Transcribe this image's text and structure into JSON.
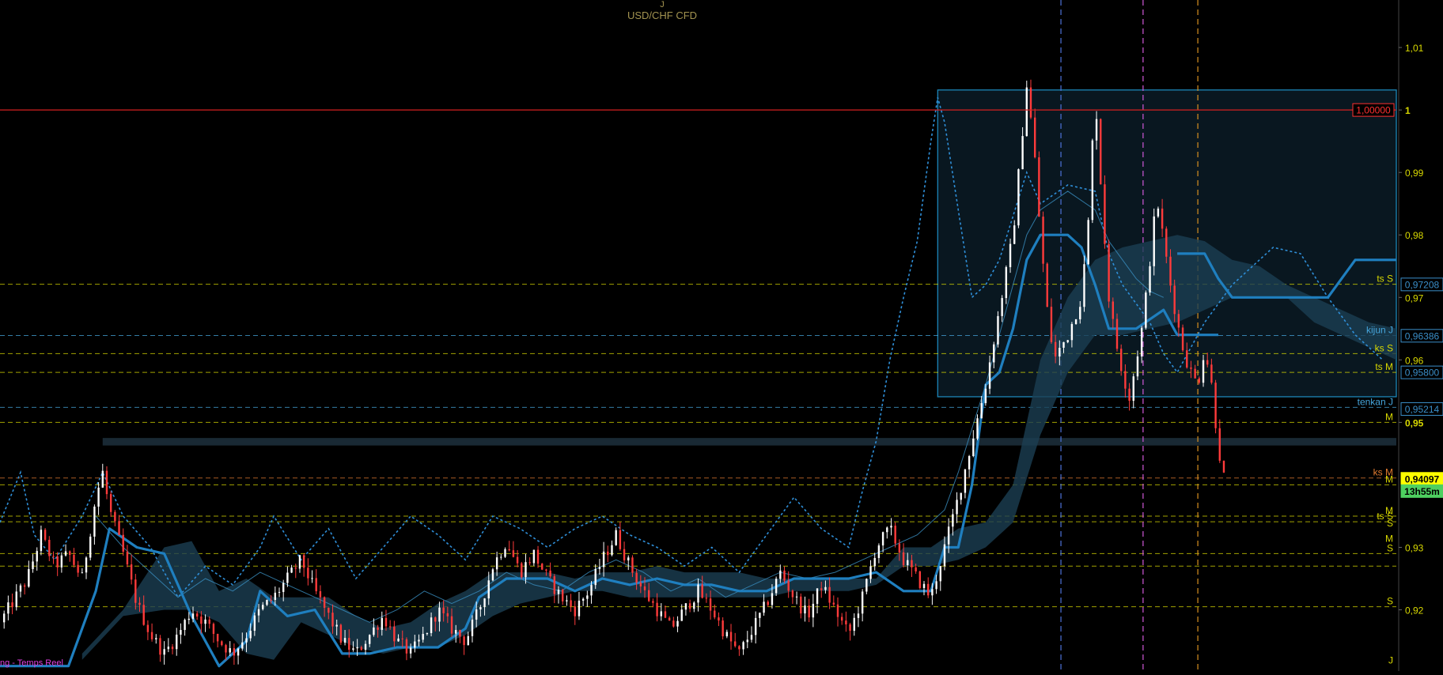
{
  "colors": {
    "background": "#000000",
    "bull_candle": "#ffffff",
    "bear_candle": "#ff3b3b",
    "kijun": "#1f7fbf",
    "tenkan_dotted": "#2f8fd8",
    "chikou_thin": "#3a8fc0",
    "cloud": "#1b3f52",
    "box_border": "#1c86b8",
    "box_fill": "#0b1b26",
    "red_line": "#d42020",
    "yellow": "#d8d800",
    "blue_label": "#46a6dc",
    "axis_text": "#d8d800",
    "title": "#a29350",
    "status": "#e040e0",
    "vline_blue": "#4c72d8",
    "vline_magenta": "#d058d8",
    "vline_orange": "#d89020"
  },
  "header": {
    "timeframe": "J",
    "instrument": "USD/CHF CFD"
  },
  "status_bar": {
    "text": "ng - Temps Reel"
  },
  "right_labels": [
    {
      "text": "ts S",
      "price": 0.9721,
      "color": "#d8d800"
    },
    {
      "text": "kijun J",
      "price": 0.9639,
      "color": "#46a6dc"
    },
    {
      "text": "ks S",
      "price": 0.961,
      "color": "#d8d800"
    },
    {
      "text": "ts M",
      "price": 0.958,
      "color": "#d8d800"
    },
    {
      "text": "tenkan J",
      "price": 0.9524,
      "color": "#46a6dc"
    },
    {
      "text": "M",
      "price": 0.95,
      "color": "#d8d800"
    },
    {
      "text": "ks M",
      "price": 0.9411,
      "color": "#e07a30"
    },
    {
      "text": "M",
      "price": 0.94,
      "color": "#d8d800"
    },
    {
      "text": "M",
      "price": 0.935,
      "color": "#d8d800"
    },
    {
      "text": "ts S",
      "price": 0.9341,
      "color": "#d8d800"
    },
    {
      "text": "S",
      "price": 0.933,
      "color": "#d8d800"
    },
    {
      "text": "M",
      "price": 0.9305,
      "color": "#d8d800"
    },
    {
      "text": "S",
      "price": 0.929,
      "color": "#d8d800"
    },
    {
      "text": "S",
      "price": 0.9205,
      "color": "#d8d800"
    },
    {
      "text": "J",
      "price": 0.911,
      "color": "#d8d800"
    }
  ],
  "price_boxes": [
    {
      "text": "1,00000",
      "price": 1.0,
      "fg": "#ff3030",
      "bg": "#000000",
      "border": "#ff3030"
    },
    {
      "text": "0,97208",
      "price": 0.97208,
      "fg": "#3a8ec8",
      "bg": "#000000",
      "border": "#3a8ec8"
    },
    {
      "text": "0,96386",
      "price": 0.96386,
      "fg": "#3a8ec8",
      "bg": "#000000",
      "border": "#3a8ec8"
    },
    {
      "text": "0,95800",
      "price": 0.958,
      "fg": "#3a8ec8",
      "bg": "#000000",
      "border": "#3a8ec8"
    },
    {
      "text": "0,95214",
      "price": 0.95214,
      "fg": "#3a8ec8",
      "bg": "#000000",
      "border": "#3a8ec8"
    },
    {
      "text": "0,94097",
      "price": 0.94097,
      "fg": "#000000",
      "bg": "#ffff00",
      "border": "#ffff00"
    },
    {
      "text": "13h55m",
      "price": 0.939,
      "fg": "#000000",
      "bg": "#4ed060",
      "border": "#4ed060"
    }
  ],
  "chart_data": {
    "type": "candlestick",
    "instrument": "USD/CHF CFD",
    "timeframe": "J",
    "y_axis": {
      "ticks": [
        "1,01",
        "1",
        "0,99",
        "0,98",
        "0,97",
        "0,96",
        "0,95",
        "0,93",
        "0,92"
      ],
      "tick_values": [
        1.01,
        1.0,
        0.99,
        0.98,
        0.97,
        0.96,
        0.95,
        0.93,
        0.92
      ],
      "bold_ticks": [
        "1",
        "0,95"
      ],
      "range": [
        0.9102,
        1.0176
      ]
    },
    "x_range": [
      0,
      204
    ],
    "last_price": 0.94097,
    "time_to_close": "13h55m",
    "resistance_line": 1.0,
    "rectangle": {
      "x0": 137,
      "x1": 204,
      "y_top": 1.0032,
      "y_bottom": 0.9541
    },
    "horizontal_zone": {
      "x0": 15,
      "x1": 204,
      "price_top": 0.9475,
      "price_bottom": 0.9463
    },
    "vertical_lines": [
      {
        "x": 155,
        "color": "#4c72d8"
      },
      {
        "x": 167,
        "color": "#d058d8"
      },
      {
        "x": 175,
        "color": "#d89020"
      }
    ],
    "level_lines": [
      {
        "price": 0.9721,
        "color": "#d8d800"
      },
      {
        "price": 0.9639,
        "color": "#46a6dc"
      },
      {
        "price": 0.961,
        "color": "#d8d800"
      },
      {
        "price": 0.958,
        "color": "#d8d800"
      },
      {
        "price": 0.9524,
        "color": "#46a6dc"
      },
      {
        "price": 0.95,
        "color": "#d8d800"
      },
      {
        "price": 0.9411,
        "color": "#e07a30"
      },
      {
        "price": 0.94,
        "color": "#d8d800"
      },
      {
        "price": 0.935,
        "color": "#d8d800"
      },
      {
        "price": 0.9341,
        "color": "#d8d800"
      },
      {
        "price": 0.929,
        "color": "#d8d800"
      },
      {
        "price": 0.927,
        "color": "#d8d800"
      },
      {
        "price": 0.9205,
        "color": "#d8d800"
      }
    ],
    "price_path": [
      [
        0,
        0.918
      ],
      [
        4,
        0.925
      ],
      [
        6,
        0.932
      ],
      [
        8,
        0.927
      ],
      [
        10,
        0.929
      ],
      [
        12,
        0.925
      ],
      [
        14,
        0.938
      ],
      [
        15,
        0.942
      ],
      [
        16,
        0.936
      ],
      [
        18,
        0.929
      ],
      [
        20,
        0.921
      ],
      [
        22,
        0.916
      ],
      [
        24,
        0.913
      ],
      [
        26,
        0.916
      ],
      [
        28,
        0.92
      ],
      [
        30,
        0.918
      ],
      [
        32,
        0.915
      ],
      [
        34,
        0.913
      ],
      [
        36,
        0.916
      ],
      [
        38,
        0.92
      ],
      [
        40,
        0.922
      ],
      [
        42,
        0.925
      ],
      [
        44,
        0.928
      ],
      [
        46,
        0.923
      ],
      [
        48,
        0.919
      ],
      [
        50,
        0.915
      ],
      [
        52,
        0.913
      ],
      [
        54,
        0.916
      ],
      [
        56,
        0.919
      ],
      [
        58,
        0.915
      ],
      [
        60,
        0.913
      ],
      [
        62,
        0.916
      ],
      [
        64,
        0.92
      ],
      [
        66,
        0.917
      ],
      [
        68,
        0.915
      ],
      [
        70,
        0.92
      ],
      [
        72,
        0.927
      ],
      [
        74,
        0.931
      ],
      [
        76,
        0.926
      ],
      [
        78,
        0.929
      ],
      [
        80,
        0.925
      ],
      [
        82,
        0.922
      ],
      [
        84,
        0.92
      ],
      [
        86,
        0.923
      ],
      [
        88,
        0.928
      ],
      [
        90,
        0.932
      ],
      [
        92,
        0.927
      ],
      [
        94,
        0.923
      ],
      [
        96,
        0.92
      ],
      [
        98,
        0.917
      ],
      [
        100,
        0.92
      ],
      [
        102,
        0.923
      ],
      [
        104,
        0.92
      ],
      [
        106,
        0.916
      ],
      [
        108,
        0.913
      ],
      [
        110,
        0.917
      ],
      [
        112,
        0.921
      ],
      [
        114,
        0.926
      ],
      [
        116,
        0.922
      ],
      [
        118,
        0.919
      ],
      [
        120,
        0.924
      ],
      [
        122,
        0.92
      ],
      [
        124,
        0.916
      ],
      [
        126,
        0.922
      ],
      [
        128,
        0.93
      ],
      [
        130,
        0.933
      ],
      [
        132,
        0.928
      ],
      [
        134,
        0.925
      ],
      [
        136,
        0.922
      ],
      [
        138,
        0.93
      ],
      [
        140,
        0.938
      ],
      [
        142,
        0.947
      ],
      [
        144,
        0.956
      ],
      [
        146,
        0.968
      ],
      [
        148,
        0.98
      ],
      [
        149,
        0.992
      ],
      [
        150,
        1.004
      ],
      [
        151,
        0.995
      ],
      [
        152,
        0.98
      ],
      [
        153,
        0.968
      ],
      [
        154,
        0.96
      ],
      [
        156,
        0.964
      ],
      [
        158,
        0.97
      ],
      [
        159,
        0.982
      ],
      [
        160,
        1.003
      ],
      [
        161,
        0.985
      ],
      [
        162,
        0.97
      ],
      [
        163,
        0.963
      ],
      [
        164,
        0.958
      ],
      [
        165,
        0.954
      ],
      [
        166,
        0.96
      ],
      [
        167,
        0.966
      ],
      [
        168,
        0.976
      ],
      [
        169,
        0.986
      ],
      [
        170,
        0.979
      ],
      [
        171,
        0.972
      ],
      [
        172,
        0.966
      ],
      [
        173,
        0.961
      ],
      [
        174,
        0.958
      ],
      [
        175,
        0.956
      ],
      [
        176,
        0.962
      ],
      [
        177,
        0.956
      ],
      [
        178,
        0.946
      ],
      [
        179,
        0.94
      ]
    ],
    "kijun": [
      [
        0,
        0.911
      ],
      [
        10,
        0.911
      ],
      [
        14,
        0.923
      ],
      [
        16,
        0.933
      ],
      [
        20,
        0.93
      ],
      [
        24,
        0.929
      ],
      [
        28,
        0.919
      ],
      [
        32,
        0.911
      ],
      [
        36,
        0.915
      ],
      [
        38,
        0.923
      ],
      [
        42,
        0.919
      ],
      [
        46,
        0.92
      ],
      [
        50,
        0.913
      ],
      [
        54,
        0.913
      ],
      [
        58,
        0.914
      ],
      [
        64,
        0.914
      ],
      [
        68,
        0.917
      ],
      [
        70,
        0.922
      ],
      [
        74,
        0.925
      ],
      [
        80,
        0.925
      ],
      [
        84,
        0.923
      ],
      [
        88,
        0.925
      ],
      [
        92,
        0.924
      ],
      [
        96,
        0.925
      ],
      [
        100,
        0.924
      ],
      [
        104,
        0.924
      ],
      [
        108,
        0.923
      ],
      [
        112,
        0.923
      ],
      [
        116,
        0.925
      ],
      [
        120,
        0.925
      ],
      [
        124,
        0.925
      ],
      [
        128,
        0.926
      ],
      [
        132,
        0.923
      ],
      [
        136,
        0.923
      ],
      [
        138,
        0.93
      ],
      [
        140,
        0.93
      ],
      [
        142,
        0.94
      ],
      [
        144,
        0.956
      ],
      [
        146,
        0.958
      ],
      [
        148,
        0.965
      ],
      [
        150,
        0.976
      ],
      [
        152,
        0.98
      ],
      [
        156,
        0.98
      ],
      [
        158,
        0.978
      ],
      [
        160,
        0.972
      ],
      [
        162,
        0.965
      ],
      [
        166,
        0.965
      ],
      [
        170,
        0.968
      ],
      [
        172,
        0.964
      ],
      [
        178,
        0.964
      ]
    ],
    "kijun_future": [
      [
        172,
        0.977
      ],
      [
        176,
        0.977
      ],
      [
        178,
        0.973
      ],
      [
        180,
        0.97
      ],
      [
        190,
        0.97
      ],
      [
        194,
        0.97
      ],
      [
        198,
        0.976
      ],
      [
        204,
        0.976
      ]
    ],
    "cloud": [
      [
        12,
        0.912,
        0.913
      ],
      [
        18,
        0.92,
        0.919
      ],
      [
        24,
        0.92,
        0.93
      ],
      [
        28,
        0.92,
        0.931
      ],
      [
        32,
        0.918,
        0.923
      ],
      [
        36,
        0.913,
        0.925
      ],
      [
        40,
        0.912,
        0.922
      ],
      [
        44,
        0.918,
        0.922
      ],
      [
        48,
        0.916,
        0.922
      ],
      [
        52,
        0.914,
        0.919
      ],
      [
        56,
        0.913,
        0.917
      ],
      [
        60,
        0.914,
        0.918
      ],
      [
        64,
        0.914,
        0.921
      ],
      [
        68,
        0.916,
        0.923
      ],
      [
        72,
        0.919,
        0.926
      ],
      [
        76,
        0.921,
        0.926
      ],
      [
        80,
        0.922,
        0.926
      ],
      [
        84,
        0.923,
        0.925
      ],
      [
        88,
        0.923,
        0.926
      ],
      [
        92,
        0.922,
        0.926
      ],
      [
        96,
        0.922,
        0.927
      ],
      [
        100,
        0.922,
        0.926
      ],
      [
        104,
        0.922,
        0.926
      ],
      [
        108,
        0.922,
        0.926
      ],
      [
        112,
        0.922,
        0.925
      ],
      [
        116,
        0.923,
        0.925
      ],
      [
        120,
        0.923,
        0.925
      ],
      [
        124,
        0.923,
        0.925
      ],
      [
        128,
        0.924,
        0.925
      ],
      [
        132,
        0.927,
        0.93
      ],
      [
        136,
        0.927,
        0.93
      ],
      [
        140,
        0.928,
        0.933
      ],
      [
        144,
        0.93,
        0.934
      ],
      [
        148,
        0.934,
        0.94
      ],
      [
        150,
        0.941,
        0.95
      ],
      [
        152,
        0.948,
        0.96
      ],
      [
        156,
        0.958,
        0.97
      ],
      [
        160,
        0.964,
        0.976
      ],
      [
        164,
        0.964,
        0.978
      ],
      [
        168,
        0.965,
        0.979
      ],
      [
        172,
        0.966,
        0.98
      ],
      [
        176,
        0.968,
        0.979
      ],
      [
        180,
        0.97,
        0.976
      ],
      [
        184,
        0.97,
        0.975
      ],
      [
        188,
        0.97,
        0.972
      ],
      [
        192,
        0.966,
        0.97
      ],
      [
        196,
        0.964,
        0.968
      ],
      [
        200,
        0.962,
        0.966
      ],
      [
        204,
        0.96,
        0.965
      ]
    ],
    "tenkan_dotted": [
      [
        0,
        0.934
      ],
      [
        3,
        0.942
      ],
      [
        5,
        0.932
      ],
      [
        8,
        0.928
      ],
      [
        12,
        0.935
      ],
      [
        15,
        0.942
      ],
      [
        18,
        0.935
      ],
      [
        22,
        0.93
      ],
      [
        26,
        0.922
      ],
      [
        30,
        0.927
      ],
      [
        34,
        0.924
      ],
      [
        38,
        0.93
      ],
      [
        40,
        0.935
      ],
      [
        44,
        0.928
      ],
      [
        48,
        0.933
      ],
      [
        52,
        0.925
      ],
      [
        56,
        0.93
      ],
      [
        60,
        0.935
      ],
      [
        64,
        0.932
      ],
      [
        68,
        0.928
      ],
      [
        72,
        0.935
      ],
      [
        76,
        0.933
      ],
      [
        80,
        0.93
      ],
      [
        84,
        0.933
      ],
      [
        88,
        0.935
      ],
      [
        92,
        0.932
      ],
      [
        96,
        0.93
      ],
      [
        100,
        0.927
      ],
      [
        104,
        0.93
      ],
      [
        108,
        0.926
      ],
      [
        112,
        0.932
      ],
      [
        116,
        0.938
      ],
      [
        120,
        0.933
      ],
      [
        124,
        0.93
      ],
      [
        126,
        0.939
      ],
      [
        128,
        0.947
      ],
      [
        130,
        0.96
      ],
      [
        132,
        0.97
      ],
      [
        134,
        0.979
      ],
      [
        136,
        0.995
      ],
      [
        137,
        1.002
      ],
      [
        138,
        0.998
      ],
      [
        140,
        0.984
      ],
      [
        142,
        0.97
      ],
      [
        144,
        0.972
      ],
      [
        146,
        0.976
      ],
      [
        150,
        0.99
      ],
      [
        152,
        0.985
      ],
      [
        156,
        0.988
      ],
      [
        160,
        0.987
      ],
      [
        162,
        0.977
      ],
      [
        164,
        0.972
      ],
      [
        166,
        0.969
      ],
      [
        168,
        0.966
      ],
      [
        170,
        0.961
      ],
      [
        172,
        0.958
      ],
      [
        176,
        0.966
      ],
      [
        180,
        0.972
      ],
      [
        184,
        0.976
      ],
      [
        186,
        0.978
      ],
      [
        190,
        0.977
      ],
      [
        194,
        0.97
      ],
      [
        198,
        0.964
      ],
      [
        202,
        0.96
      ]
    ],
    "chikou_thin": [
      [
        14,
        0.935
      ],
      [
        18,
        0.93
      ],
      [
        22,
        0.926
      ],
      [
        26,
        0.922
      ],
      [
        30,
        0.925
      ],
      [
        34,
        0.923
      ],
      [
        38,
        0.926
      ],
      [
        42,
        0.924
      ],
      [
        46,
        0.922
      ],
      [
        50,
        0.92
      ],
      [
        54,
        0.918
      ],
      [
        58,
        0.92
      ],
      [
        62,
        0.923
      ],
      [
        66,
        0.921
      ],
      [
        70,
        0.923
      ],
      [
        74,
        0.926
      ],
      [
        78,
        0.924
      ],
      [
        82,
        0.923
      ],
      [
        86,
        0.926
      ],
      [
        90,
        0.928
      ],
      [
        94,
        0.926
      ],
      [
        98,
        0.923
      ],
      [
        102,
        0.925
      ],
      [
        106,
        0.922
      ],
      [
        110,
        0.924
      ],
      [
        114,
        0.926
      ],
      [
        118,
        0.925
      ],
      [
        122,
        0.926
      ],
      [
        126,
        0.928
      ],
      [
        130,
        0.93
      ],
      [
        134,
        0.932
      ],
      [
        138,
        0.936
      ],
      [
        140,
        0.942
      ],
      [
        142,
        0.949
      ],
      [
        144,
        0.956
      ],
      [
        146,
        0.964
      ],
      [
        148,
        0.972
      ],
      [
        150,
        0.98
      ],
      [
        152,
        0.984
      ],
      [
        156,
        0.987
      ],
      [
        160,
        0.984
      ],
      [
        162,
        0.979
      ],
      [
        164,
        0.976
      ],
      [
        166,
        0.973
      ],
      [
        168,
        0.971
      ],
      [
        170,
        0.97
      ]
    ]
  }
}
